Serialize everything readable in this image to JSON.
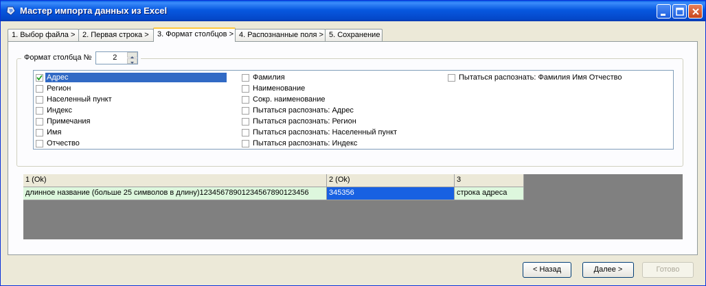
{
  "window": {
    "title": "Мастер импорта данных из Excel"
  },
  "tabs": [
    {
      "label": "1. Выбор файла >"
    },
    {
      "label": "2. Первая строка >"
    },
    {
      "label": "3. Формат столбцов >"
    },
    {
      "label": "4. Распознанные поля >"
    },
    {
      "label": "5. Сохранение"
    }
  ],
  "column_format": {
    "label": "Формат столбца №",
    "value": "2"
  },
  "fields": {
    "col1": [
      {
        "label": "Адрес",
        "checked": true,
        "selected": true
      },
      {
        "label": "Регион",
        "checked": false
      },
      {
        "label": "Населенный пункт",
        "checked": false
      },
      {
        "label": "Индекс",
        "checked": false
      },
      {
        "label": "Примечания",
        "checked": false
      },
      {
        "label": "Имя",
        "checked": false
      },
      {
        "label": "Отчество",
        "checked": false
      }
    ],
    "col2": [
      {
        "label": "Фамилия",
        "checked": false
      },
      {
        "label": "Наименование",
        "checked": false
      },
      {
        "label": "Сокр. наименование",
        "checked": false
      },
      {
        "label": "Пытаться распознать: Адрес",
        "checked": false
      },
      {
        "label": "Пытаться распознать: Регион",
        "checked": false
      },
      {
        "label": "Пытаться распознать: Населенный пункт",
        "checked": false
      },
      {
        "label": "Пытаться распознать: Индекс",
        "checked": false
      }
    ],
    "col3": [
      {
        "label": "Пытаться распознать: Фамилия Имя Отчество",
        "checked": false
      }
    ]
  },
  "preview": {
    "headers": [
      "1 (Ok)",
      "2 (Ok)",
      "3"
    ],
    "rows": [
      [
        "длинное название (больше 25 символов в длину)12345678901234567890123456",
        "345356",
        "строка адреса"
      ]
    ]
  },
  "buttons": {
    "back": "< Назад",
    "next": "Далее >",
    "finish": "Готово"
  }
}
